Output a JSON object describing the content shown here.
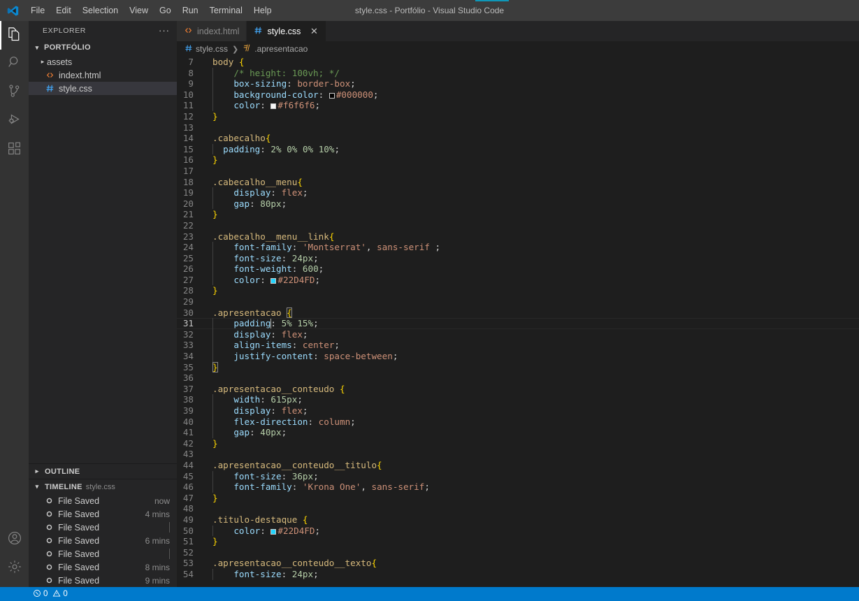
{
  "window": {
    "title": "style.css - Portfólio - Visual Studio Code",
    "logo_icon": "vscode-logo-icon",
    "progress_visible": true
  },
  "menubar": {
    "items": [
      {
        "label": "File"
      },
      {
        "label": "Edit"
      },
      {
        "label": "Selection"
      },
      {
        "label": "View"
      },
      {
        "label": "Go"
      },
      {
        "label": "Run"
      },
      {
        "label": "Terminal"
      },
      {
        "label": "Help"
      }
    ]
  },
  "activitybar": {
    "top": [
      {
        "name": "explorer",
        "icon": "files-icon",
        "active": true
      },
      {
        "name": "search",
        "icon": "search-icon",
        "active": false
      },
      {
        "name": "source-control",
        "icon": "source-control-icon",
        "active": false
      },
      {
        "name": "run-debug",
        "icon": "run-debug-icon",
        "active": false
      },
      {
        "name": "extensions",
        "icon": "extensions-icon",
        "active": false
      }
    ],
    "bottom": [
      {
        "name": "accounts",
        "icon": "account-icon"
      },
      {
        "name": "settings",
        "icon": "gear-icon"
      }
    ]
  },
  "sidebar": {
    "title": "EXPLORER",
    "more_actions": "···",
    "folder": {
      "name": "PORTFÓLIO",
      "expanded": true,
      "children": [
        {
          "label": "assets",
          "icon": "folder-icon",
          "type": "folder",
          "expanded": false,
          "selected": false
        },
        {
          "label": "indext.html",
          "icon": "html-icon",
          "type": "file",
          "selected": false
        },
        {
          "label": "style.css",
          "icon": "css-icon",
          "type": "file",
          "selected": true
        }
      ]
    },
    "outline": {
      "label": "OUTLINE",
      "expanded": false
    },
    "timeline": {
      "label": "TIMELINE",
      "subtitle": "style.css",
      "expanded": true,
      "items": [
        {
          "label": "File Saved",
          "time": "now"
        },
        {
          "label": "File Saved",
          "time": "4 mins"
        },
        {
          "label": "File Saved",
          "time": ""
        },
        {
          "label": "File Saved",
          "time": "6 mins"
        },
        {
          "label": "File Saved",
          "time": ""
        },
        {
          "label": "File Saved",
          "time": "8 mins"
        },
        {
          "label": "File Saved",
          "time": "9 mins"
        }
      ]
    }
  },
  "tabs": [
    {
      "label": "indext.html",
      "icon": "html-icon",
      "active": false,
      "closable": false
    },
    {
      "label": "style.css",
      "icon": "css-icon",
      "active": true,
      "closable": true
    }
  ],
  "breadcrumbs": [
    {
      "label": "style.css",
      "icon": "css-icon"
    },
    {
      "label": ".apresentacao",
      "icon": "css-rule-icon"
    }
  ],
  "editor": {
    "active_line": 31,
    "first_line": 7,
    "lines": [
      {
        "n": 7,
        "tokens": [
          {
            "t": "sel",
            "v": "body "
          },
          {
            "t": "brace",
            "v": "{"
          }
        ]
      },
      {
        "n": 8,
        "indent": 1,
        "tokens": [
          {
            "t": "cmt",
            "v": "    /* height: 100vh; */"
          }
        ]
      },
      {
        "n": 9,
        "indent": 1,
        "tokens": [
          {
            "t": "prop",
            "v": "    box-sizing"
          },
          {
            "t": "punc",
            "v": ": "
          },
          {
            "t": "val",
            "v": "border-box"
          },
          {
            "t": "punc",
            "v": ";"
          }
        ]
      },
      {
        "n": 10,
        "indent": 1,
        "tokens": [
          {
            "t": "prop",
            "v": "    background-color"
          },
          {
            "t": "punc",
            "v": ": "
          },
          {
            "t": "swatch",
            "v": "#000000"
          },
          {
            "t": "val",
            "v": "#000000"
          },
          {
            "t": "punc",
            "v": ";"
          }
        ]
      },
      {
        "n": 11,
        "indent": 1,
        "tokens": [
          {
            "t": "prop",
            "v": "    color"
          },
          {
            "t": "punc",
            "v": ": "
          },
          {
            "t": "swatch",
            "v": "#f6f6f6"
          },
          {
            "t": "val",
            "v": "#f6f6f6"
          },
          {
            "t": "punc",
            "v": ";"
          }
        ]
      },
      {
        "n": 12,
        "tokens": [
          {
            "t": "brace",
            "v": "}"
          }
        ]
      },
      {
        "n": 13,
        "tokens": []
      },
      {
        "n": 14,
        "tokens": [
          {
            "t": "sel",
            "v": ".cabecalho"
          },
          {
            "t": "brace",
            "v": "{"
          }
        ]
      },
      {
        "n": 15,
        "indent": 1,
        "tokens": [
          {
            "t": "prop",
            "v": "  padding"
          },
          {
            "t": "punc",
            "v": ": "
          },
          {
            "t": "num",
            "v": "2%"
          },
          {
            "t": "punc",
            "v": " "
          },
          {
            "t": "num",
            "v": "0%"
          },
          {
            "t": "punc",
            "v": " "
          },
          {
            "t": "num",
            "v": "0%"
          },
          {
            "t": "punc",
            "v": " "
          },
          {
            "t": "num",
            "v": "10%"
          },
          {
            "t": "punc",
            "v": ";"
          }
        ]
      },
      {
        "n": 16,
        "tokens": [
          {
            "t": "brace",
            "v": "}"
          }
        ]
      },
      {
        "n": 17,
        "tokens": []
      },
      {
        "n": 18,
        "tokens": [
          {
            "t": "sel",
            "v": ".cabecalho__menu"
          },
          {
            "t": "brace",
            "v": "{"
          }
        ]
      },
      {
        "n": 19,
        "indent": 1,
        "tokens": [
          {
            "t": "prop",
            "v": "    display"
          },
          {
            "t": "punc",
            "v": ": "
          },
          {
            "t": "val",
            "v": "flex"
          },
          {
            "t": "punc",
            "v": ";"
          }
        ]
      },
      {
        "n": 20,
        "indent": 1,
        "tokens": [
          {
            "t": "prop",
            "v": "    gap"
          },
          {
            "t": "punc",
            "v": ": "
          },
          {
            "t": "num",
            "v": "80px"
          },
          {
            "t": "punc",
            "v": ";"
          }
        ]
      },
      {
        "n": 21,
        "tokens": [
          {
            "t": "brace",
            "v": "}"
          }
        ]
      },
      {
        "n": 22,
        "tokens": []
      },
      {
        "n": 23,
        "tokens": [
          {
            "t": "sel",
            "v": ".cabecalho__menu__link"
          },
          {
            "t": "brace",
            "v": "{"
          }
        ]
      },
      {
        "n": 24,
        "indent": 1,
        "tokens": [
          {
            "t": "prop",
            "v": "    font-family"
          },
          {
            "t": "punc",
            "v": ": "
          },
          {
            "t": "str",
            "v": "'Montserrat'"
          },
          {
            "t": "punc",
            "v": ", "
          },
          {
            "t": "val",
            "v": "sans-serif"
          },
          {
            "t": "punc",
            "v": " ;"
          }
        ]
      },
      {
        "n": 25,
        "indent": 1,
        "tokens": [
          {
            "t": "prop",
            "v": "    font-size"
          },
          {
            "t": "punc",
            "v": ": "
          },
          {
            "t": "num",
            "v": "24px"
          },
          {
            "t": "punc",
            "v": ";"
          }
        ]
      },
      {
        "n": 26,
        "indent": 1,
        "tokens": [
          {
            "t": "prop",
            "v": "    font-weight"
          },
          {
            "t": "punc",
            "v": ": "
          },
          {
            "t": "num",
            "v": "600"
          },
          {
            "t": "punc",
            "v": ";"
          }
        ]
      },
      {
        "n": 27,
        "indent": 1,
        "tokens": [
          {
            "t": "prop",
            "v": "    color"
          },
          {
            "t": "punc",
            "v": ": "
          },
          {
            "t": "swatch",
            "v": "#22D4FD"
          },
          {
            "t": "val",
            "v": "#22D4FD"
          },
          {
            "t": "punc",
            "v": ";"
          }
        ]
      },
      {
        "n": 28,
        "tokens": [
          {
            "t": "brace",
            "v": "}"
          }
        ]
      },
      {
        "n": 29,
        "tokens": []
      },
      {
        "n": 30,
        "tokens": [
          {
            "t": "sel",
            "v": ".apresentacao "
          },
          {
            "t": "brace-match",
            "v": "{"
          }
        ]
      },
      {
        "n": 31,
        "indent": 1,
        "active": true,
        "tokens": [
          {
            "t": "prop",
            "v": "    padding"
          },
          {
            "t": "cursor",
            "v": ""
          },
          {
            "t": "punc",
            "v": ": "
          },
          {
            "t": "num",
            "v": "5%"
          },
          {
            "t": "punc",
            "v": " "
          },
          {
            "t": "num",
            "v": "15%"
          },
          {
            "t": "punc",
            "v": ";"
          }
        ]
      },
      {
        "n": 32,
        "indent": 1,
        "tokens": [
          {
            "t": "prop",
            "v": "    display"
          },
          {
            "t": "punc",
            "v": ": "
          },
          {
            "t": "val",
            "v": "flex"
          },
          {
            "t": "punc",
            "v": ";"
          }
        ]
      },
      {
        "n": 33,
        "indent": 1,
        "tokens": [
          {
            "t": "prop",
            "v": "    align-items"
          },
          {
            "t": "punc",
            "v": ": "
          },
          {
            "t": "val",
            "v": "center"
          },
          {
            "t": "punc",
            "v": ";"
          }
        ]
      },
      {
        "n": 34,
        "indent": 1,
        "tokens": [
          {
            "t": "prop",
            "v": "    justify-content"
          },
          {
            "t": "punc",
            "v": ": "
          },
          {
            "t": "val",
            "v": "space-between"
          },
          {
            "t": "punc",
            "v": ";"
          }
        ]
      },
      {
        "n": 35,
        "tokens": [
          {
            "t": "brace-match",
            "v": "}"
          }
        ]
      },
      {
        "n": 36,
        "tokens": []
      },
      {
        "n": 37,
        "tokens": [
          {
            "t": "sel",
            "v": ".apresentacao__conteudo "
          },
          {
            "t": "brace",
            "v": "{"
          }
        ]
      },
      {
        "n": 38,
        "indent": 1,
        "tokens": [
          {
            "t": "prop",
            "v": "    width"
          },
          {
            "t": "punc",
            "v": ": "
          },
          {
            "t": "num",
            "v": "615px"
          },
          {
            "t": "punc",
            "v": ";"
          }
        ]
      },
      {
        "n": 39,
        "indent": 1,
        "tokens": [
          {
            "t": "prop",
            "v": "    display"
          },
          {
            "t": "punc",
            "v": ": "
          },
          {
            "t": "val",
            "v": "flex"
          },
          {
            "t": "punc",
            "v": ";"
          }
        ]
      },
      {
        "n": 40,
        "indent": 1,
        "tokens": [
          {
            "t": "prop",
            "v": "    flex-direction"
          },
          {
            "t": "punc",
            "v": ": "
          },
          {
            "t": "val",
            "v": "column"
          },
          {
            "t": "punc",
            "v": ";"
          }
        ]
      },
      {
        "n": 41,
        "indent": 1,
        "tokens": [
          {
            "t": "prop",
            "v": "    gap"
          },
          {
            "t": "punc",
            "v": ": "
          },
          {
            "t": "num",
            "v": "40px"
          },
          {
            "t": "punc",
            "v": ";"
          }
        ]
      },
      {
        "n": 42,
        "tokens": [
          {
            "t": "brace",
            "v": "}"
          }
        ]
      },
      {
        "n": 43,
        "tokens": []
      },
      {
        "n": 44,
        "tokens": [
          {
            "t": "sel",
            "v": ".apresentacao__conteudo__titulo"
          },
          {
            "t": "brace",
            "v": "{"
          }
        ]
      },
      {
        "n": 45,
        "indent": 1,
        "tokens": [
          {
            "t": "prop",
            "v": "    font-size"
          },
          {
            "t": "punc",
            "v": ": "
          },
          {
            "t": "num",
            "v": "36px"
          },
          {
            "t": "punc",
            "v": ";"
          }
        ]
      },
      {
        "n": 46,
        "indent": 1,
        "tokens": [
          {
            "t": "prop",
            "v": "    font-family"
          },
          {
            "t": "punc",
            "v": ": "
          },
          {
            "t": "str",
            "v": "'Krona One'"
          },
          {
            "t": "punc",
            "v": ", "
          },
          {
            "t": "val",
            "v": "sans-serif"
          },
          {
            "t": "punc",
            "v": ";"
          }
        ]
      },
      {
        "n": 47,
        "tokens": [
          {
            "t": "brace",
            "v": "}"
          }
        ]
      },
      {
        "n": 48,
        "tokens": []
      },
      {
        "n": 49,
        "tokens": [
          {
            "t": "sel",
            "v": ".titulo-destaque "
          },
          {
            "t": "brace",
            "v": "{"
          }
        ]
      },
      {
        "n": 50,
        "indent": 1,
        "tokens": [
          {
            "t": "prop",
            "v": "    color"
          },
          {
            "t": "punc",
            "v": ": "
          },
          {
            "t": "swatch",
            "v": "#22D4FD"
          },
          {
            "t": "val",
            "v": "#22D4FD"
          },
          {
            "t": "punc",
            "v": ";"
          }
        ]
      },
      {
        "n": 51,
        "tokens": [
          {
            "t": "brace",
            "v": "}"
          }
        ]
      },
      {
        "n": 52,
        "tokens": []
      },
      {
        "n": 53,
        "tokens": [
          {
            "t": "sel",
            "v": ".apresentacao__conteudo__texto"
          },
          {
            "t": "brace",
            "v": "{"
          }
        ]
      },
      {
        "n": 54,
        "indent": 1,
        "tokens": [
          {
            "t": "prop",
            "v": "    font-size"
          },
          {
            "t": "punc",
            "v": ": "
          },
          {
            "t": "num",
            "v": "24px"
          },
          {
            "t": "punc",
            "v": ";"
          }
        ]
      }
    ]
  },
  "statusbar": {
    "errors": "0",
    "warnings": "0",
    "error_icon": "error-circle-icon",
    "warning_icon": "warning-triangle-icon"
  },
  "colors": {
    "accent": "#007acc",
    "progress": "#0e97b8",
    "titlebar_bg": "#3c3c3c",
    "sidebar_bg": "#252526",
    "editor_bg": "#1e1e1e",
    "activitybar_bg": "#333333"
  }
}
